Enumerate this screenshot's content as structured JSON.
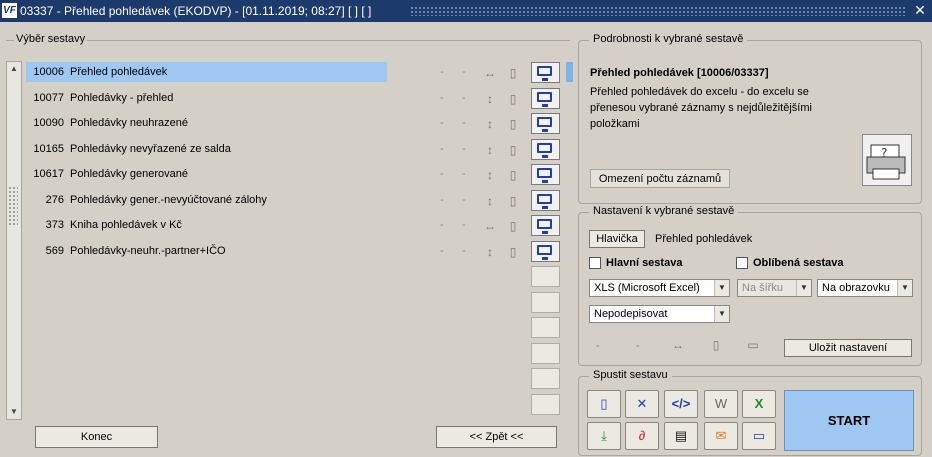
{
  "window": {
    "title": "03337 - Přehled pohledávek (EKODVP) - [01.11.2019; 08:27]  [ ]  [ ]",
    "logo_text": "VF",
    "close_glyph": "✕"
  },
  "left": {
    "group_label": "Výběr sestavy",
    "rows": [
      {
        "num": "10006",
        "name": "Přehled pohledávek",
        "c1": "-",
        "c2": "-",
        "arrow": "↔",
        "selected": true
      },
      {
        "num": "10077",
        "name": "Pohledávky - přehled",
        "c1": "-",
        "c2": "-",
        "arrow": "↕",
        "selected": false
      },
      {
        "num": "10090",
        "name": "Pohledávky neuhrazené",
        "c1": "-",
        "c2": "-",
        "arrow": "↕",
        "selected": false
      },
      {
        "num": "10165",
        "name": "Pohledávky nevyřazené ze salda",
        "c1": "-",
        "c2": "-",
        "arrow": "↕",
        "selected": false
      },
      {
        "num": "10617",
        "name": "Pohledávky generované",
        "c1": "-",
        "c2": "-",
        "arrow": "↕",
        "selected": false
      },
      {
        "num": "276",
        "name": "Pohledávky gener.-nevyúčtované zálohy",
        "c1": "-",
        "c2": "-",
        "arrow": "↕",
        "selected": false
      },
      {
        "num": "373",
        "name": "Kniha pohledávek v Kč",
        "c1": "-",
        "c2": "-",
        "arrow": "↔",
        "selected": false
      },
      {
        "num": "569",
        "name": "Pohledávky-neuhr.-partner+IČO",
        "c1": "-",
        "c2": "-",
        "arrow": "↕",
        "selected": false
      }
    ],
    "konec_label": "Konec",
    "zpet_label": "<< Zpět <<"
  },
  "details": {
    "group_label": "Podrobnosti k vybrané sestavě",
    "title": "Přehled pohledávek [10006/03337]",
    "description": "Přehled pohledávek do excelu - do excelu se přenesou vybrané záznamy s nejdůležitějšími položkami",
    "limit_button": "Omezení počtu záznamů"
  },
  "settings": {
    "group_label": "Nastavení k vybrané sestavě",
    "header_button": "Hlavička",
    "header_value": "Přehled pohledávek",
    "main_report_label": "Hlavní sestava",
    "favorite_label": "Oblíbená sestava",
    "format_value": "XLS (Microsoft Excel)",
    "orientation_value": "Na šířku",
    "output_value": "Na obrazovku",
    "signature_value": "Nepodepisovat",
    "dash1": "-",
    "dash2": "-",
    "save_button": "Uložit nastavení"
  },
  "run": {
    "group_label": "Spustit sestavu",
    "start_label": "START"
  }
}
